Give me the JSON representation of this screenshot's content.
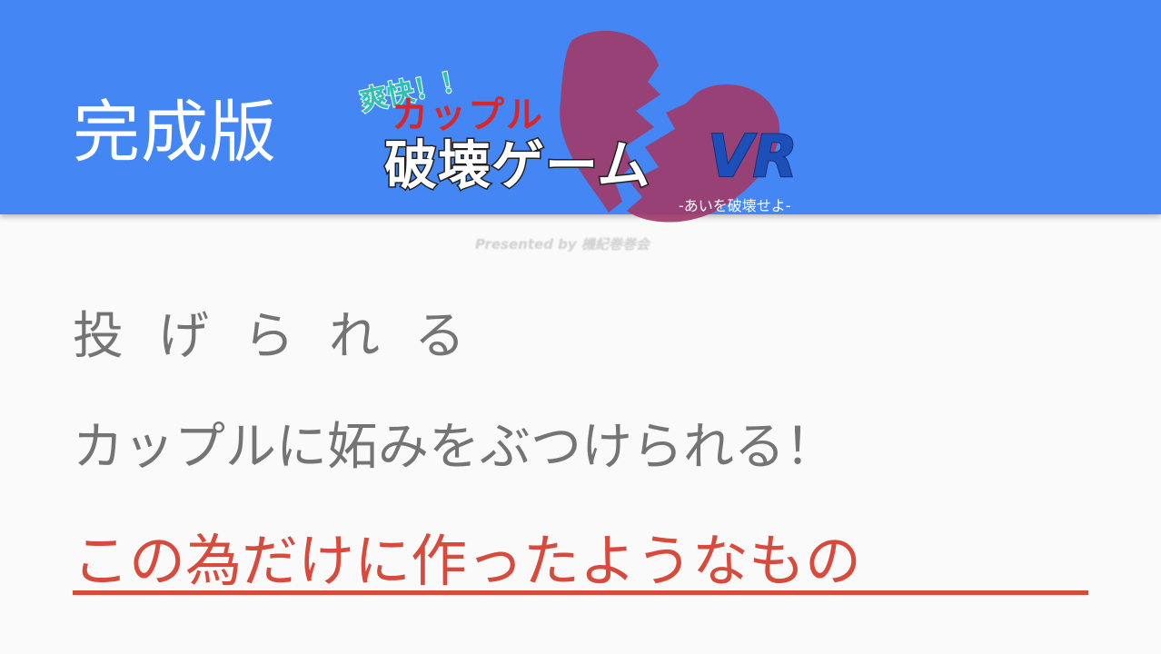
{
  "header": {
    "title": "完成版"
  },
  "logo": {
    "catch": "爽快！！",
    "couple": "カップル",
    "main": "破壊ゲーム",
    "vr": "VR",
    "sub": "-あいを破壊せよ-"
  },
  "presented_by": "Presented by 機紀巻巻会",
  "content": {
    "line1": "投げられる",
    "line2": "カップルに妬みをぶつけられる！",
    "line3": "この為だけに作ったようなもの"
  },
  "colors": {
    "header_bg": "#4486f4",
    "text_gray": "#747474",
    "accent_red": "#d84a3c",
    "heart": "#a03c6a"
  }
}
